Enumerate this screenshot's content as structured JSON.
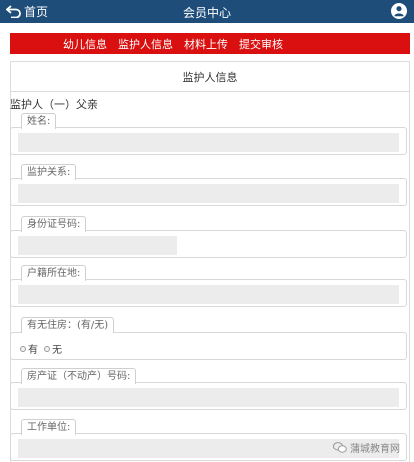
{
  "header": {
    "back_label": "首页",
    "title": "会员中心"
  },
  "tabs": [
    {
      "label": "幼儿信息"
    },
    {
      "label": "监护人信息"
    },
    {
      "label": "材料上传"
    },
    {
      "label": "提交审核"
    }
  ],
  "panel": {
    "title": "监护人信息"
  },
  "section": {
    "label": "监护人（一）父亲"
  },
  "fields": {
    "name": {
      "label": "姓名:",
      "value": ""
    },
    "relation": {
      "label": "监护关系:",
      "value": ""
    },
    "id_number": {
      "label": "身份证号码:",
      "value": ""
    },
    "household": {
      "label": "户籍所在地:",
      "value": ""
    },
    "has_property": {
      "label": "有无住房：(有/无)",
      "options": [
        "有",
        "无"
      ]
    },
    "property_cert": {
      "label": "房产证（不动产）号码:",
      "value": ""
    },
    "employer": {
      "label": "工作单位:",
      "value": ""
    }
  },
  "watermark": {
    "text": "蒲城教育网"
  },
  "colors": {
    "header_bg": "#1f4d7a",
    "tab_bar_bg": "#d9100f",
    "input_bg": "#ececec"
  }
}
